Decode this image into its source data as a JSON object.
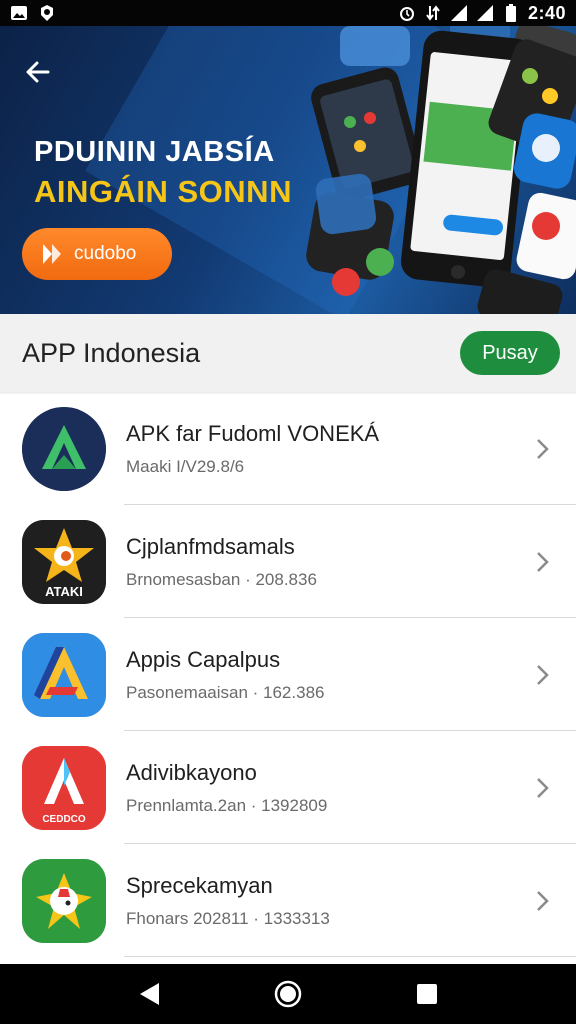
{
  "status_bar": {
    "time": "2:40",
    "icons": [
      "gallery-icon",
      "settings-icon",
      "alarm-icon",
      "data-icon",
      "signal-icon",
      "signal-icon",
      "battery-icon"
    ]
  },
  "banner": {
    "line1": "PDUININ JABSÍA",
    "line2": "AINGÁIN SONNN",
    "cta_label": "cudobo",
    "colors": {
      "accent_yellow": "#f5c518",
      "cta_orange": "#f26a10"
    }
  },
  "section": {
    "title": "APP Indonesia",
    "button_label": "Pusay",
    "button_color": "#1e8e3e"
  },
  "apps": [
    {
      "name": "APK far Fudoml VONEKÁ",
      "meta": "Mаaki I/V29.8/6",
      "icon": "apk-logo-icon"
    },
    {
      "name": "Cjplanfmdsamals",
      "meta": "Brnomesasban · 208.836",
      "icon": "star-logo-icon",
      "icon_text": "ATAKI"
    },
    {
      "name": "Appis Capalpus",
      "meta": "Pasonemaaisan · 162.386",
      "icon": "a-logo-icon"
    },
    {
      "name": "Adivibkayono",
      "meta": "Prennlamta.2an · 1392809",
      "icon": "red-a-logo-icon",
      "icon_text": "CEDDCO"
    },
    {
      "name": "Sprecekamyan",
      "meta": "Fhonars 202811 · 1333313",
      "icon": "bird-logo-icon"
    }
  ],
  "nav": {
    "items": [
      "back-icon",
      "home-icon",
      "recents-icon"
    ]
  }
}
